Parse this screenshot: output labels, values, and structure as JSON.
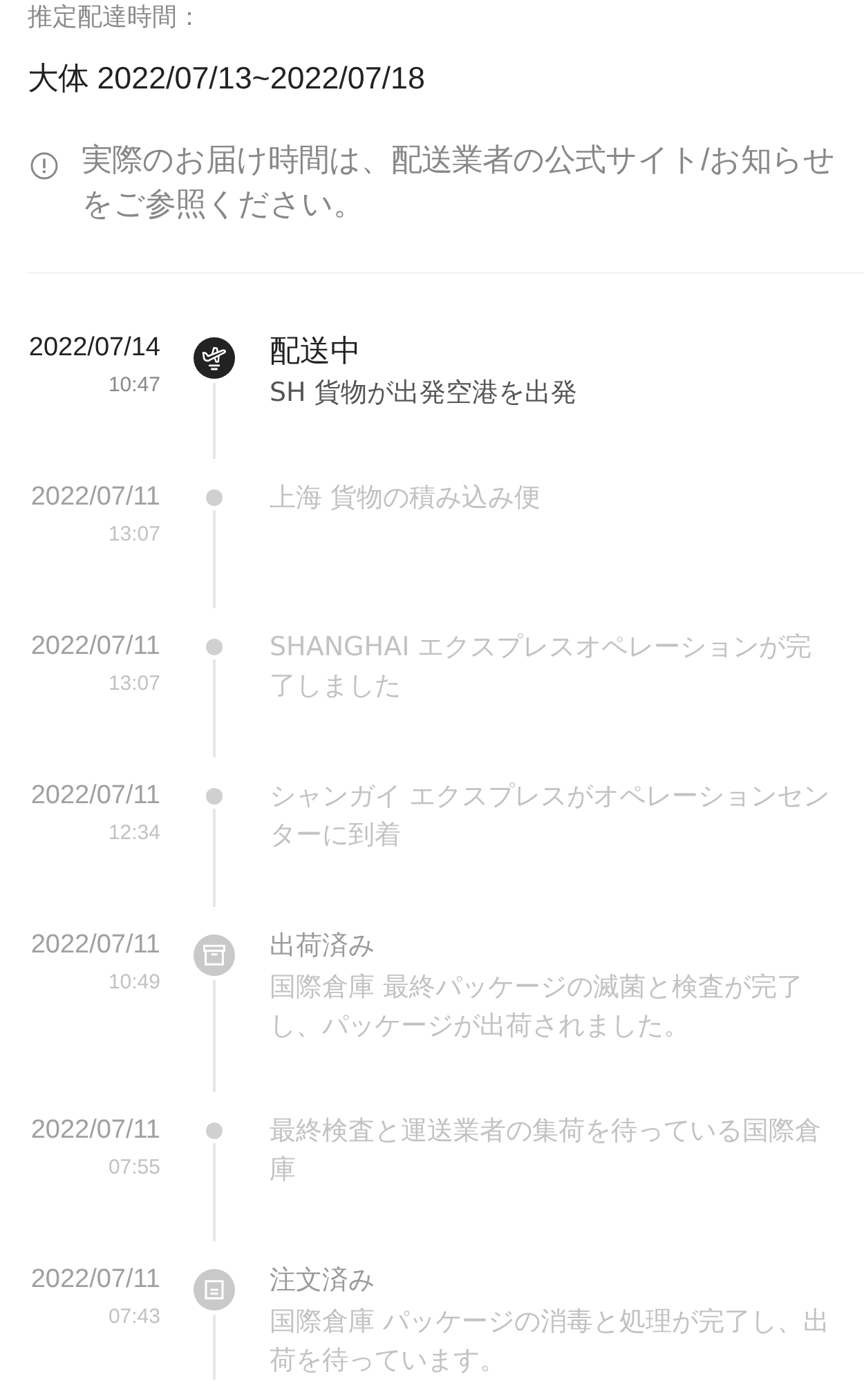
{
  "estimate": {
    "label": "推定配達時間：",
    "value": "大体 2022/07/13~2022/07/18"
  },
  "notice": {
    "text": "実際のお届け時間は、配送業者の公式サイト/お知らせをご参照ください。"
  },
  "events": [
    {
      "date": "2022/07/14",
      "time": "10:47",
      "kind": "plane",
      "current": true,
      "title": "配送中",
      "description": "SH 貨物が出発空港を出発"
    },
    {
      "date": "2022/07/11",
      "time": "13:07",
      "kind": "dot",
      "current": false,
      "description": "上海 貨物の積み込み便"
    },
    {
      "date": "2022/07/11",
      "time": "13:07",
      "kind": "dot",
      "current": false,
      "description": "SHANGHAI エクスプレスオペレーションが完了しました"
    },
    {
      "date": "2022/07/11",
      "time": "12:34",
      "kind": "dot",
      "current": false,
      "description": "シャンガイ エクスプレスがオペレーションセンターに到着"
    },
    {
      "date": "2022/07/11",
      "time": "10:49",
      "kind": "box",
      "current": false,
      "title": "出荷済み",
      "description": "国際倉庫 最終パッケージの滅菌と検査が完了し、パッケージが出荷されました。"
    },
    {
      "date": "2022/07/11",
      "time": "07:55",
      "kind": "dot",
      "current": false,
      "description": "最終検査と運送業者の集荷を待っている国際倉庫"
    },
    {
      "date": "2022/07/11",
      "time": "07:43",
      "kind": "document",
      "current": false,
      "title": "注文済み",
      "description": "国際倉庫 パッケージの消毒と処理が完了し、出荷を待っています。"
    }
  ]
}
